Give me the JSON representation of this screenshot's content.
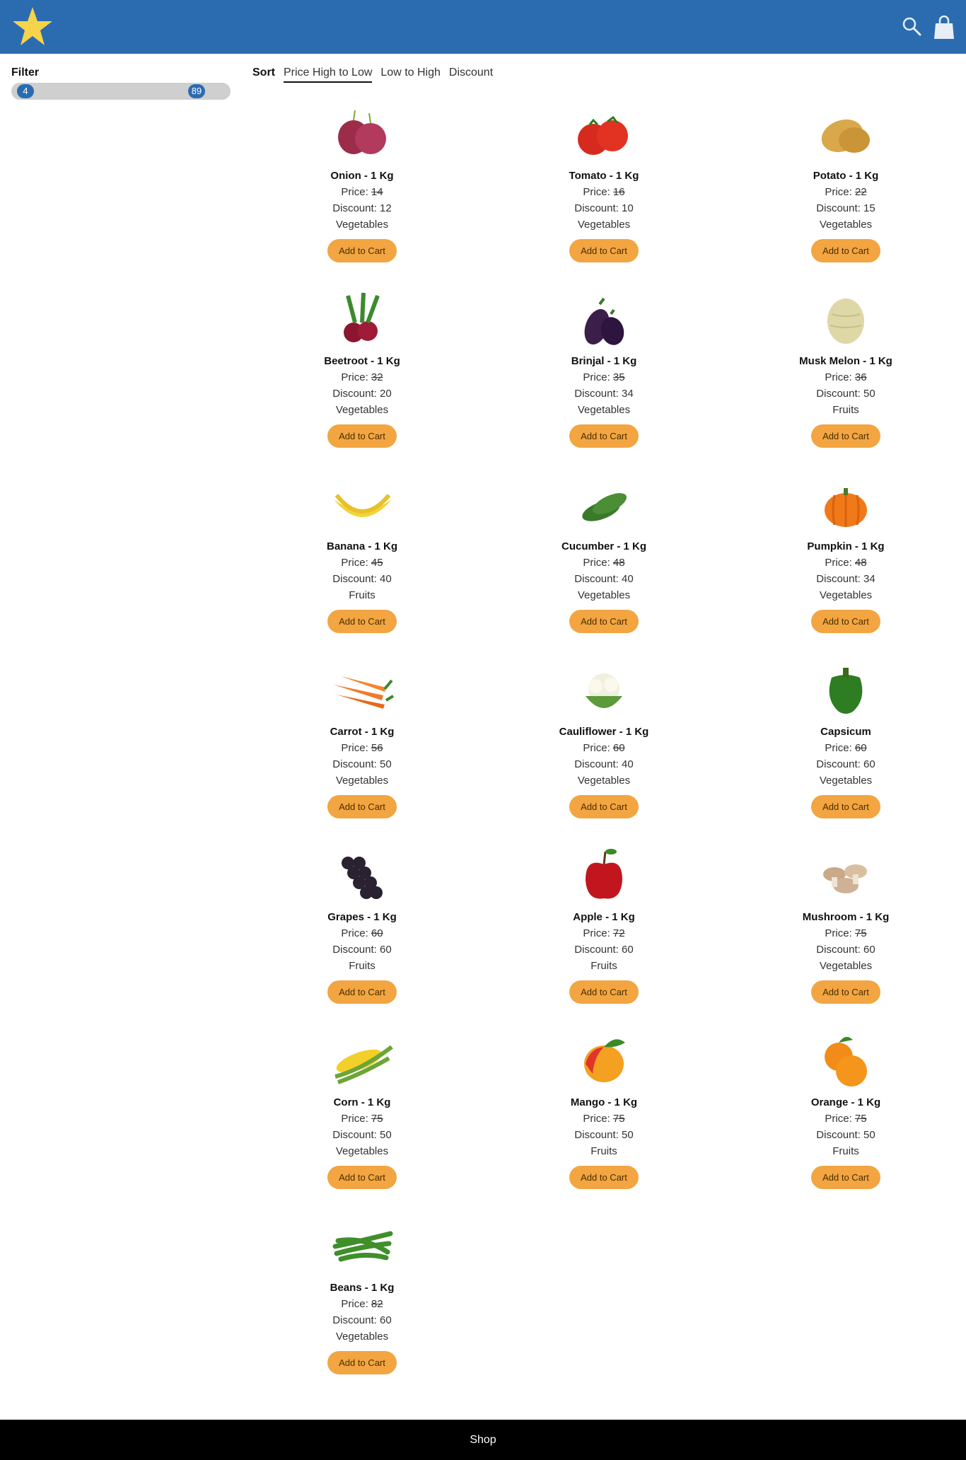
{
  "header": {
    "logo_icon": "star-icon",
    "search_icon": "search-icon",
    "cart_icon": "shopping-bag-icon",
    "bg": "#2b6cb0"
  },
  "filter": {
    "title": "Filter",
    "min_value": "4",
    "max_value": "89"
  },
  "sort": {
    "label": "Sort",
    "options": [
      {
        "label": "Price High to Low",
        "active": true
      },
      {
        "label": "Low to High",
        "active": false
      },
      {
        "label": "Discount",
        "active": false
      }
    ]
  },
  "products": [
    {
      "name": "Onion - 1 Kg",
      "price_label": "Price: ",
      "price": "14",
      "discount": "Discount: 12",
      "category": "Vegetables",
      "button": "Add to Cart",
      "icon": "onion"
    },
    {
      "name": "Tomato - 1 Kg",
      "price_label": "Price: ",
      "price": "16",
      "discount": "Discount: 10",
      "category": "Vegetables",
      "button": "Add to Cart",
      "icon": "tomato"
    },
    {
      "name": "Potato - 1 Kg",
      "price_label": "Price: ",
      "price": "22",
      "discount": "Discount: 15",
      "category": "Vegetables",
      "button": "Add to Cart",
      "icon": "potato"
    },
    {
      "name": "Beetroot - 1 Kg",
      "price_label": "Price: ",
      "price": "32",
      "discount": "Discount: 20",
      "category": "Vegetables",
      "button": "Add to Cart",
      "icon": "beetroot"
    },
    {
      "name": "Brinjal - 1 Kg",
      "price_label": "Price: ",
      "price": "35",
      "discount": "Discount: 34",
      "category": "Vegetables",
      "button": "Add to Cart",
      "icon": "brinjal"
    },
    {
      "name": "Musk Melon - 1 Kg",
      "price_label": "Price: ",
      "price": "36",
      "discount": "Discount: 50",
      "category": "Fruits",
      "button": "Add to Cart",
      "icon": "melon"
    },
    {
      "name": "Banana - 1 Kg",
      "price_label": "Price: ",
      "price": "45",
      "discount": "Discount: 40",
      "category": "Fruits",
      "button": "Add to Cart",
      "icon": "banana"
    },
    {
      "name": "Cucumber - 1 Kg",
      "price_label": "Price: ",
      "price": "48",
      "discount": "Discount: 40",
      "category": "Vegetables",
      "button": "Add to Cart",
      "icon": "cucumber"
    },
    {
      "name": "Pumpkin - 1 Kg",
      "price_label": "Price: ",
      "price": "48",
      "discount": "Discount: 34",
      "category": "Vegetables",
      "button": "Add to Cart",
      "icon": "pumpkin"
    },
    {
      "name": "Carrot - 1 Kg",
      "price_label": "Price: ",
      "price": "56",
      "discount": "Discount: 50",
      "category": "Vegetables",
      "button": "Add to Cart",
      "icon": "carrot"
    },
    {
      "name": "Cauliflower - 1 Kg",
      "price_label": "Price: ",
      "price": "60",
      "discount": "Discount: 40",
      "category": "Vegetables",
      "button": "Add to Cart",
      "icon": "cauliflower"
    },
    {
      "name": "Capsicum",
      "price_label": "Price: ",
      "price": "60",
      "discount": "Discount: 60",
      "category": "Vegetables",
      "button": "Add to Cart",
      "icon": "capsicum"
    },
    {
      "name": "Grapes - 1 Kg",
      "price_label": "Price: ",
      "price": "60",
      "discount": "Discount: 60",
      "category": "Fruits",
      "button": "Add to Cart",
      "icon": "grapes"
    },
    {
      "name": "Apple - 1 Kg",
      "price_label": "Price: ",
      "price": "72",
      "discount": "Discount: 60",
      "category": "Fruits",
      "button": "Add to Cart",
      "icon": "apple"
    },
    {
      "name": "Mushroom - 1 Kg",
      "price_label": "Price: ",
      "price": "75",
      "discount": "Discount: 60",
      "category": "Vegetables",
      "button": "Add to Cart",
      "icon": "mushroom"
    },
    {
      "name": "Corn - 1 Kg",
      "price_label": "Price: ",
      "price": "75",
      "discount": "Discount: 50",
      "category": "Vegetables",
      "button": "Add to Cart",
      "icon": "corn"
    },
    {
      "name": "Mango - 1 Kg",
      "price_label": "Price: ",
      "price": "75",
      "discount": "Discount: 50",
      "category": "Fruits",
      "button": "Add to Cart",
      "icon": "mango"
    },
    {
      "name": "Orange - 1 Kg",
      "price_label": "Price: ",
      "price": "75",
      "discount": "Discount: 50",
      "category": "Fruits",
      "button": "Add to Cart",
      "icon": "orange"
    },
    {
      "name": "Beans - 1 Kg",
      "price_label": "Price: ",
      "price": "82",
      "discount": "Discount: 60",
      "category": "Vegetables",
      "button": "Add to Cart",
      "icon": "beans"
    }
  ],
  "footer": {
    "label": "Shop"
  }
}
